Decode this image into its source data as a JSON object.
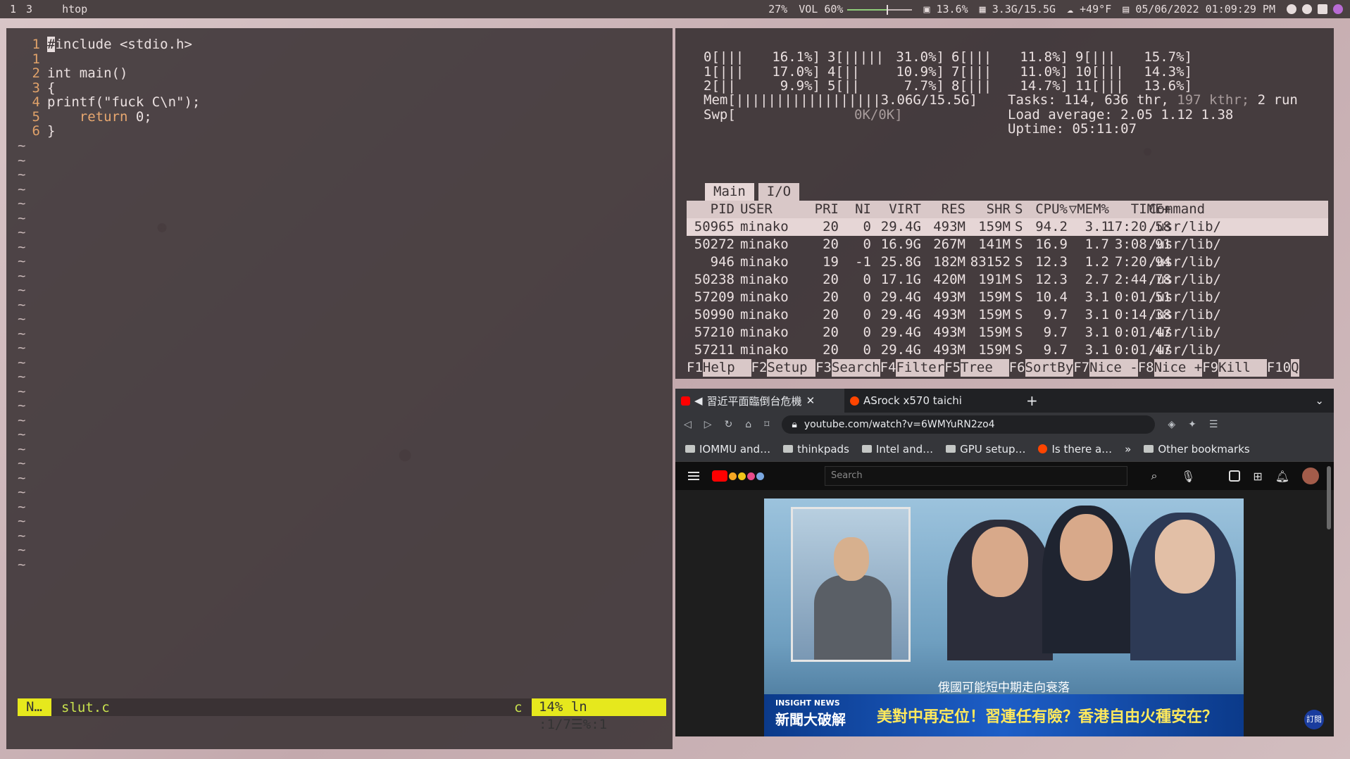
{
  "topbar": {
    "workspaces": [
      "1",
      "3"
    ],
    "window_title": "htop",
    "brightness": "27%",
    "volume_label": "VOL 60%",
    "volume_level": 0.6,
    "cpu": "13.6%",
    "memory": "3.3G/15.5G",
    "weather": "+49°F",
    "datetime": "05/06/2022 01:09:29 PM"
  },
  "vim": {
    "lines": [
      {
        "num": "1",
        "text": "#include <stdio.h>"
      },
      {
        "num": "1",
        "text": ""
      },
      {
        "num": "2",
        "text": "int main()"
      },
      {
        "num": "3",
        "text": "{"
      },
      {
        "num": "4",
        "text": "printf(\"fuck C\\n\");"
      },
      {
        "num": "5",
        "text": "    return 0;"
      },
      {
        "num": "6",
        "text": "}"
      }
    ],
    "cursor_char": "#",
    "first_line_rest": "include <stdio.h>",
    "return_kw": "return",
    "return_rest": " 0;",
    "tilde": "~",
    "status": {
      "mode": "N…",
      "filename": "slut.c",
      "filetype": "c",
      "position": "14% ln :1/7☰%:1"
    }
  },
  "htop": {
    "cpus": [
      {
        "id": "0",
        "bar": "[|||",
        "pct": "16.1%]"
      },
      {
        "id": "1",
        "bar": "[|||",
        "pct": "17.0%]"
      },
      {
        "id": "2",
        "bar": "[||",
        "pct": "9.9%]"
      },
      {
        "id": "3",
        "bar": "[|||||",
        "pct": "31.0%]"
      },
      {
        "id": "4",
        "bar": "[||",
        "pct": "10.9%]"
      },
      {
        "id": "5",
        "bar": "[||",
        "pct": "7.7%]"
      },
      {
        "id": "6",
        "bar": "[|||",
        "pct": "11.8%]"
      },
      {
        "id": "7",
        "bar": "[|||",
        "pct": "11.0%]"
      },
      {
        "id": "8",
        "bar": "[|||",
        "pct": "14.7%]"
      },
      {
        "id": "9",
        "bar": "[|||",
        "pct": "15.7%]"
      },
      {
        "id": "10",
        "bar": "[|||",
        "pct": "14.3%]"
      },
      {
        "id": "11",
        "bar": "[|||",
        "pct": "13.6%]"
      }
    ],
    "mem": "Mem[||||||||||||||||||3.06G/15.5G]",
    "swp_label": "Swp[",
    "swp_value": "0K/0K]",
    "tasks_label": "Tasks:",
    "tasks": "114, 636 thr,",
    "kthr": "197 kthr;",
    "running": "2 run",
    "load_label": "Load average:",
    "load": "2.05 1.12 1.38",
    "uptime_label": "Uptime:",
    "uptime": "05:11:07",
    "tabs": [
      "Main",
      "I/O"
    ],
    "columns": [
      "PID",
      "USER",
      "PRI",
      "NI",
      "VIRT",
      "RES",
      "SHR",
      "S",
      "CPU%",
      "▽MEM%",
      "TIME+",
      "Command"
    ],
    "processes": [
      [
        "50965",
        "minako",
        "20",
        "0",
        "29.4G",
        "493M",
        "159M",
        "S",
        "94.2",
        "3.1",
        "17:20.58",
        "/usr/lib/"
      ],
      [
        "50272",
        "minako",
        "20",
        "0",
        "16.9G",
        "267M",
        "141M",
        "S",
        "16.9",
        "1.7",
        "3:08.91",
        "/usr/lib/"
      ],
      [
        "946",
        "minako",
        "19",
        "-1",
        "25.8G",
        "182M",
        "83152",
        "S",
        "12.3",
        "1.2",
        "7:20.94",
        "/usr/lib/"
      ],
      [
        "50238",
        "minako",
        "20",
        "0",
        "17.1G",
        "420M",
        "191M",
        "S",
        "12.3",
        "2.7",
        "2:44.78",
        "/usr/lib/"
      ],
      [
        "57209",
        "minako",
        "20",
        "0",
        "29.4G",
        "493M",
        "159M",
        "S",
        "10.4",
        "3.1",
        "0:01.51",
        "/usr/lib/"
      ],
      [
        "50990",
        "minako",
        "20",
        "0",
        "29.4G",
        "493M",
        "159M",
        "S",
        "9.7",
        "3.1",
        "0:14.38",
        "/usr/lib/"
      ],
      [
        "57210",
        "minako",
        "20",
        "0",
        "29.4G",
        "493M",
        "159M",
        "S",
        "9.7",
        "3.1",
        "0:01.47",
        "/usr/lib/"
      ],
      [
        "57211",
        "minako",
        "20",
        "0",
        "29.4G",
        "493M",
        "159M",
        "S",
        "9.7",
        "3.1",
        "0:01.47",
        "/usr/lib/"
      ]
    ],
    "fkeys": [
      {
        "key": "F1",
        "label": "Help  "
      },
      {
        "key": "F2",
        "label": "Setup "
      },
      {
        "key": "F3",
        "label": "Search"
      },
      {
        "key": "F4",
        "label": "Filter"
      },
      {
        "key": "F5",
        "label": "Tree  "
      },
      {
        "key": "F6",
        "label": "SortBy"
      },
      {
        "key": "F7",
        "label": "Nice -"
      },
      {
        "key": "F8",
        "label": "Nice +"
      },
      {
        "key": "F9",
        "label": "Kill  "
      },
      {
        "key": "F10",
        "label": "Q"
      }
    ]
  },
  "browser": {
    "tabs": [
      {
        "title": "習近平面臨倒台危機",
        "icon": "youtube-icon"
      },
      {
        "title": "ASrock x570 taichi",
        "icon": "reddit-icon"
      }
    ],
    "url": "youtube.com/watch?v=6WMYuRN2zo4",
    "bookmarks": [
      "IOMMU and…",
      "thinkpads",
      "Intel and…",
      "GPU setup…",
      "Is there a…"
    ],
    "more_bookmarks": "»",
    "other_bookmarks": "Other bookmarks",
    "search_placeholder": "Search",
    "video": {
      "caption": "俄國可能短中期走向衰落",
      "headline": "美對中再定位！習連任有險？香港自由火種安在？",
      "show_name": "新聞大破解",
      "brand": "INSIGHT NEWS",
      "subscribe": "訂閱"
    }
  }
}
